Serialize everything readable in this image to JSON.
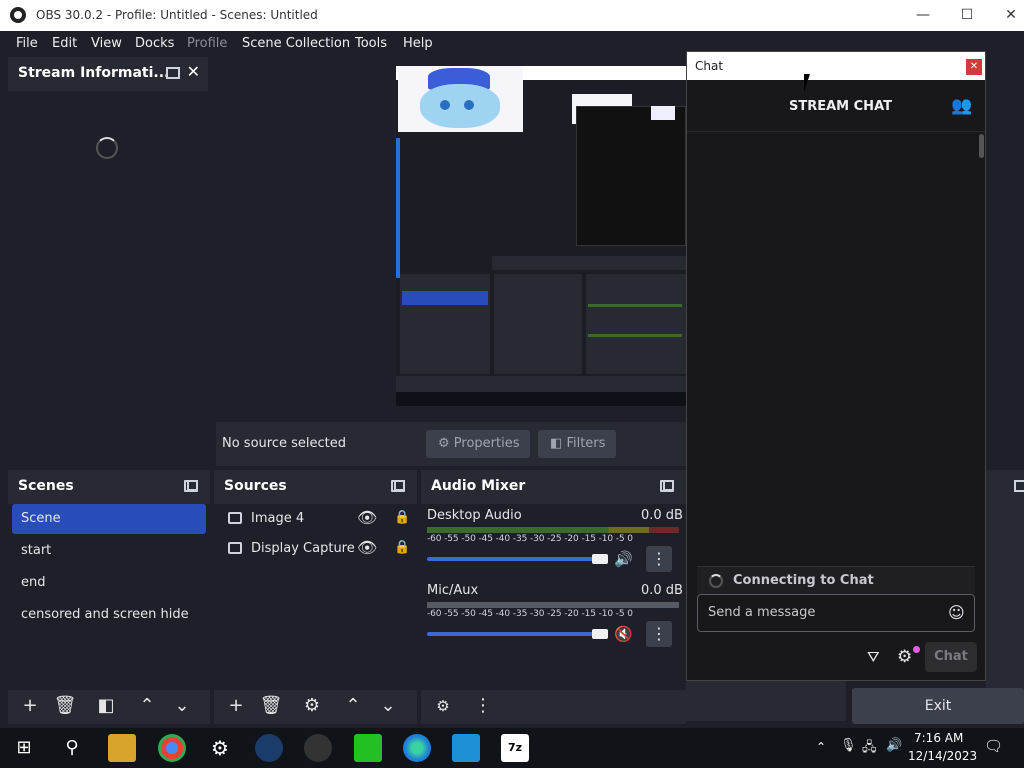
{
  "window": {
    "title": "OBS 30.0.2 - Profile: Untitled - Scenes: Untitled",
    "minimize": "—",
    "maximize": "☐",
    "close": "✕"
  },
  "menu": [
    "File",
    "Edit",
    "View",
    "Docks",
    "Profile",
    "Scene Collection",
    "Tools",
    "Help"
  ],
  "stream_info": {
    "title": "Stream Informati..."
  },
  "preview": {
    "no_source": "No source selected",
    "properties": "Properties",
    "filters": "Filters"
  },
  "scenes": {
    "title": "Scenes",
    "items": [
      "Scene",
      "start",
      "end",
      "censored and screen hide"
    ]
  },
  "sources": {
    "title": "Sources",
    "items": [
      "Image 4",
      "Display Capture"
    ]
  },
  "audio": {
    "title": "Audio Mixer",
    "ticks": "-60 -55 -50 -45 -40 -35 -30 -25 -20 -15 -10  -5   0",
    "channels": [
      {
        "name": "Desktop Audio",
        "db": "0.0 dB",
        "muted": false
      },
      {
        "name": "Mic/Aux",
        "db": "0.0 dB",
        "muted": true
      }
    ]
  },
  "chat": {
    "window_title": "Chat",
    "header": "STREAM CHAT",
    "status": "Connecting to Chat",
    "input_placeholder": "Send a message",
    "send": "Chat"
  },
  "controls": {
    "exit": "Exit"
  },
  "taskbar": {
    "time": "7:16 AM",
    "date": "12/14/2023"
  },
  "colors": {
    "accent": "#284cb8",
    "panel": "#272a33",
    "background": "#1e1f29"
  }
}
